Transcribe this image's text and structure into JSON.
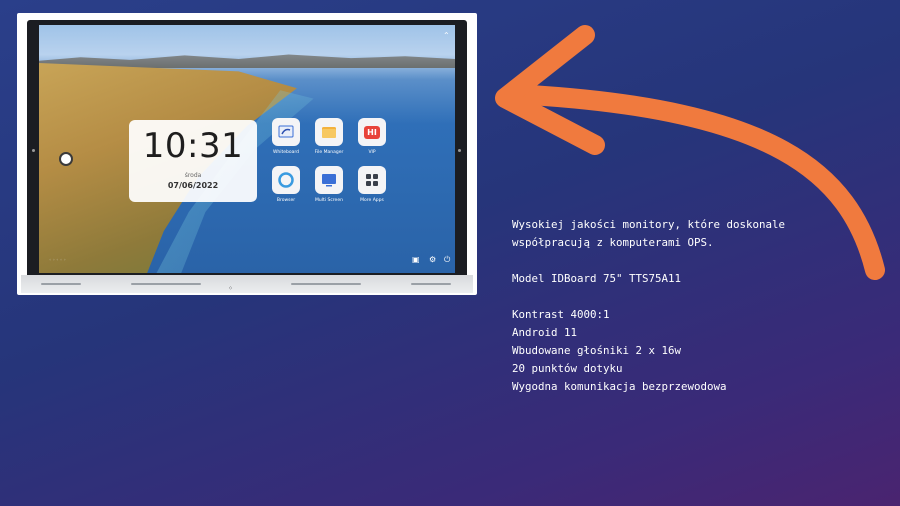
{
  "device": {
    "clock": {
      "time": "10:31",
      "day": "środa",
      "date": "07/06/2022"
    },
    "apps": [
      {
        "label": "Whiteboard",
        "icon": "whiteboard-icon"
      },
      {
        "label": "File Manager",
        "icon": "folder-icon"
      },
      {
        "label": "VIP",
        "icon": "hi-icon",
        "badge": "HI"
      },
      {
        "label": "Browser",
        "icon": "browser-icon"
      },
      {
        "label": "Multi Screen",
        "icon": "multi-screen-icon"
      },
      {
        "label": "More Apps",
        "icon": "grid-icon"
      }
    ]
  },
  "info": {
    "intro_line1": "Wysokiej jakości monitory, które doskonale",
    "intro_line2": "współpracują z komputerami OPS.",
    "model": "Model IDBoard 75\" TTS75A11",
    "specs": [
      "Kontrast 4000:1",
      "Android 11",
      "Wbudowane głośniki 2 x 16w",
      "20 punktów dotyku",
      "Wygodna komunikacja bezprzewodowa"
    ]
  },
  "colors": {
    "arrow": "#f07a3e",
    "background": "#2a3a86"
  }
}
